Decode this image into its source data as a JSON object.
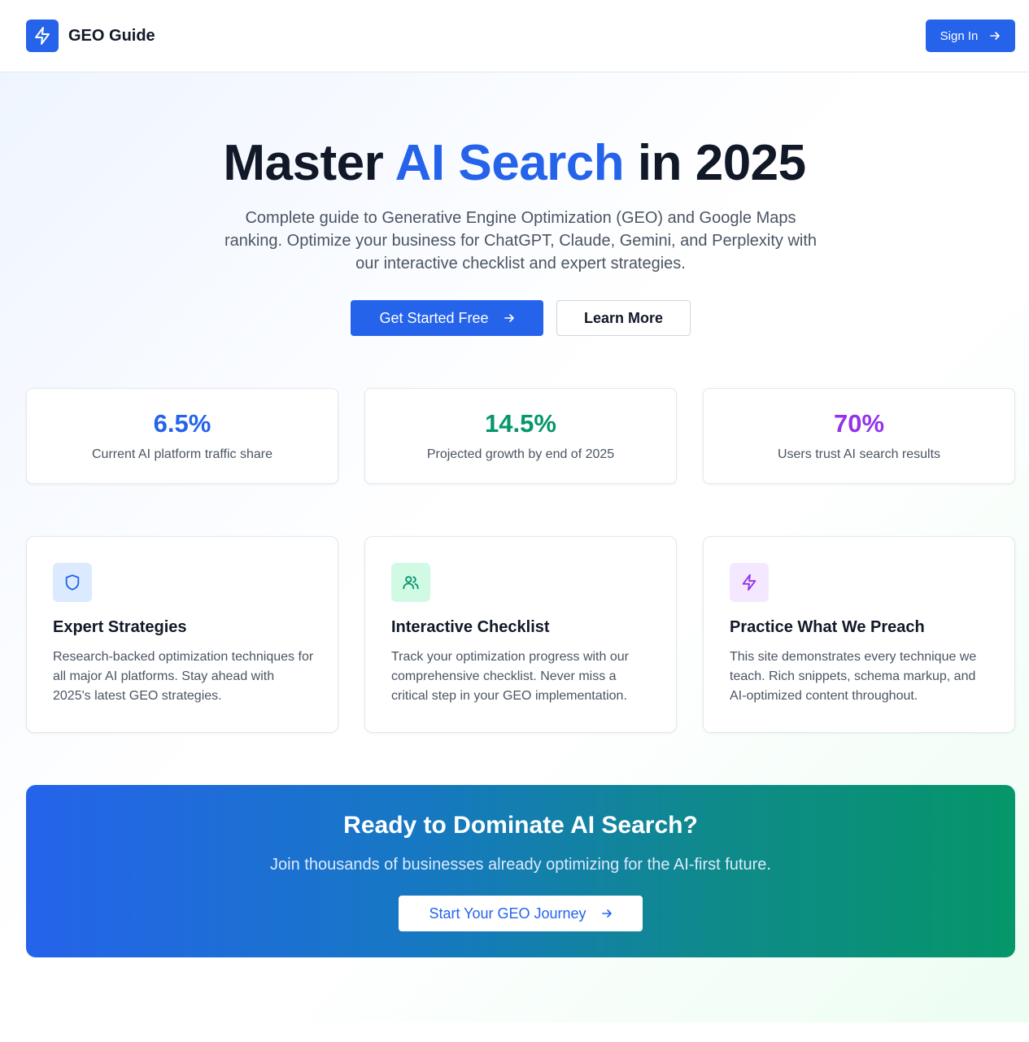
{
  "header": {
    "brand": "GEO Guide",
    "sign_in_label": "Sign In"
  },
  "hero": {
    "title_part1": "Master ",
    "title_accent": "AI Search",
    "title_part2": " in 2025",
    "subtitle": "Complete guide to Generative Engine Optimization (GEO) and Google Maps ranking. Optimize your business for ChatGPT, Claude, Gemini, and Perplexity with our interactive checklist and expert strategies.",
    "primary_cta": "Get Started Free",
    "secondary_cta": "Learn More"
  },
  "stats": [
    {
      "value": "6.5%",
      "label": "Current AI platform traffic share",
      "color": "#2563eb"
    },
    {
      "value": "14.5%",
      "label": "Projected growth by end of 2025",
      "color": "#059669"
    },
    {
      "value": "70%",
      "label": "Users trust AI search results",
      "color": "#9333ea"
    }
  ],
  "features": [
    {
      "icon": "shield-icon",
      "title": "Expert Strategies",
      "description": "Research-backed optimization techniques for all major AI platforms. Stay ahead with 2025's latest GEO strategies."
    },
    {
      "icon": "users-icon",
      "title": "Interactive Checklist",
      "description": "Track your optimization progress with our comprehensive checklist. Never miss a critical step in your GEO implementation."
    },
    {
      "icon": "lightning-icon",
      "title": "Practice What We Preach",
      "description": "This site demonstrates every technique we teach. Rich snippets, schema markup, and AI-optimized content throughout."
    }
  ],
  "cta": {
    "title": "Ready to Dominate AI Search?",
    "subtitle": "Join thousands of businesses already optimizing for the AI-first future.",
    "button": "Start Your GEO Journey"
  },
  "colors": {
    "primary": "#2563eb",
    "green": "#059669",
    "purple": "#9333ea"
  }
}
